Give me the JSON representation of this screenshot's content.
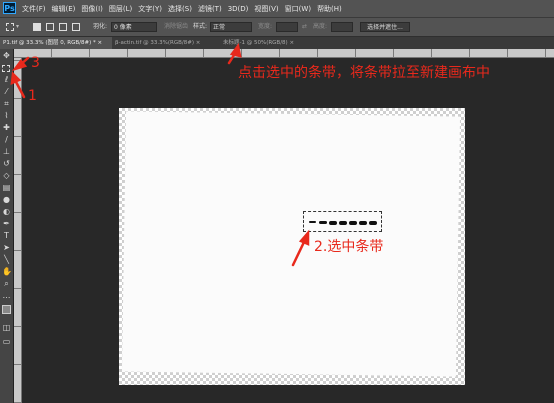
{
  "menubar": {
    "logo": "Ps",
    "items": [
      "文件(F)",
      "编辑(E)",
      "图像(I)",
      "图层(L)",
      "文字(Y)",
      "选择(S)",
      "滤镜(T)",
      "3D(D)",
      "视图(V)",
      "窗口(W)",
      "帮助(H)"
    ]
  },
  "options": {
    "feather_label": "羽化:",
    "feather_value": "0 像素",
    "antialias": "消除锯齿",
    "style_label": "样式:",
    "style_value": "正常",
    "width_label": "宽度:",
    "height_label": "高度:",
    "select_mask": "选择并遮住..."
  },
  "tabs": [
    {
      "label": "P1.tif @ 33.3% (图层 0, RGB/8#) *",
      "close": "×"
    },
    {
      "label": "β-actin.tif @ 33.3%(RGB/8#)",
      "close": "×"
    },
    {
      "label": "未标题-1 @ 50%(RGB/8)",
      "close": "×"
    }
  ],
  "annotations": {
    "top_instruction": "点击选中的条带，将条带拉至新建画布中",
    "step2": "2.选中条带",
    "num1": "1",
    "num3": "3"
  },
  "colors": {
    "annotation": "#e8291c",
    "logo_accent": "#31a8ff"
  }
}
